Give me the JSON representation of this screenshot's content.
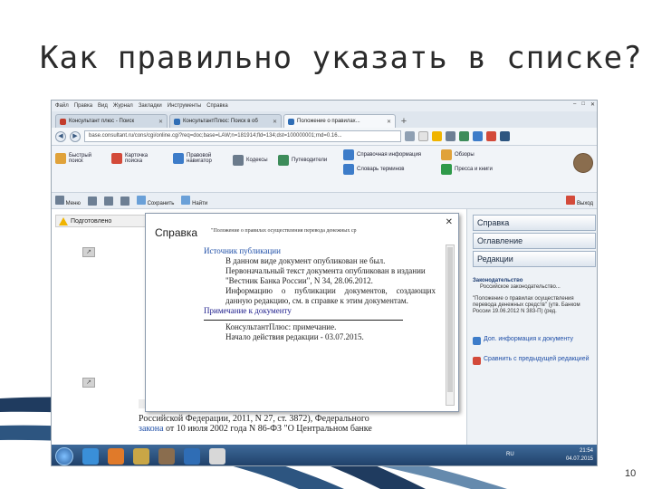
{
  "slide": {
    "title": "Как правильно указать в списке?",
    "page_number": "10"
  },
  "browser": {
    "menu": [
      "Файл",
      "Правка",
      "Вид",
      "Журнал",
      "Закладки",
      "Инструменты",
      "Справка"
    ],
    "tabs": [
      {
        "label": "Консультант плюс - Поиск",
        "icon": "google-icon"
      },
      {
        "label": "КонсультантПлюс: Поиск в об",
        "icon": "consultant-icon"
      },
      {
        "label": "Положение о правилах...",
        "icon": "consultant-icon"
      }
    ],
    "url": "base.consultant.ru/cons/cgi/online.cgi?req=doc;base=LAW;n=181914;fld=134;dst=100000001;rnd=0.16...",
    "window_controls": [
      "–",
      "□",
      "✕"
    ]
  },
  "ribbon": {
    "items": [
      {
        "label": "Быстрый поиск",
        "color": "#e0a23a"
      },
      {
        "label": "Карточка поиска",
        "color": "#d34a3a"
      },
      {
        "label": "Правовой навигатор",
        "color": "#3d7cc9"
      },
      {
        "label": "Кодексы",
        "color": "#6b7b8c"
      },
      {
        "label": "Путеводители",
        "color": "#3d8c5a"
      },
      {
        "label": "Справочная информация",
        "color": "#3d7cc9"
      },
      {
        "label": "Словарь терминов",
        "color": "#3d7cc9"
      },
      {
        "label": "Обзоры",
        "color": "#e0a23a"
      },
      {
        "label": "Пресса и книги",
        "color": "#2f9a4a"
      }
    ]
  },
  "toolbar": {
    "items": [
      "Меню",
      "Сохранить",
      "Найти"
    ],
    "right": "Выход"
  },
  "document": {
    "warning": "Подготовлено",
    "text_lines": [
      "Российской Федерации, 2011, N 27, ст. 3872), Федерального",
      "закона от 10 июля 2002 года N 86-ФЗ \"О Центральном банке"
    ],
    "link_word": "закона"
  },
  "dialog": {
    "title": "Справка",
    "subtitle": "\"Положение о правилах осуществления перевода денежных ср",
    "section1": "Источник публикации",
    "pub_lines": [
      "В данном виде документ опубликован не был.",
      "Первоначальный текст документа опубликован в издании",
      "\"Вестник Банка России\", N 34, 28.06.2012.",
      "Информацию о публикации документов, создающих данную редакцию, см. в справке к этим документам."
    ],
    "section2": "Примечание к документу",
    "note_lines": [
      "КонсультантПлюс: примечание.",
      "Начало действия редакции - 03.07.2015."
    ]
  },
  "right_panel": {
    "buttons": [
      "Справка",
      "Оглавление",
      "Редакции"
    ],
    "box_header": "Законодательство",
    "box_sub": "Российское законодательство...",
    "box_text": "\"Положение о правилах осуществления перевода денежных средств\" (утв. Банком России 19.06.2012 N 383-П) (ред.",
    "links": [
      {
        "label": "Доп. информация к документу",
        "color": "#3d7cc9"
      },
      {
        "label": "Сравнить с предыдущей редакцией",
        "color": "#d34a3a"
      }
    ]
  },
  "taskbar": {
    "lang": "RU",
    "time": "21:54",
    "date": "04.07.2015"
  }
}
